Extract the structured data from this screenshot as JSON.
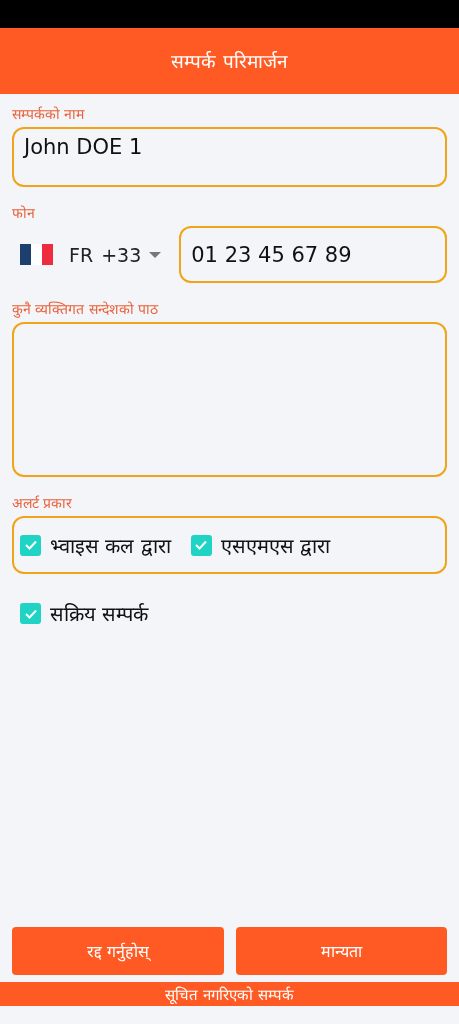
{
  "header": {
    "title": "सम्पर्क परिमार्जन"
  },
  "name_field": {
    "label": "सम्पर्कको नाम",
    "value": "John DOE 1"
  },
  "phone": {
    "label": "फोन",
    "country": "FR",
    "dial_code": "+33",
    "value": "01 23 45 67 89"
  },
  "message_field": {
    "label": "कुनै व्यक्तिगत सन्देशको पाठ"
  },
  "alert_type": {
    "label": "अलर्ट प्रकार",
    "options": [
      {
        "label": "भ्वाइस कल द्वारा",
        "checked": true
      },
      {
        "label": "एसएमएस द्वारा",
        "checked": true
      }
    ]
  },
  "active_contact": {
    "label": "सक्रिय सम्पर्क",
    "checked": true
  },
  "buttons": [
    "रद्द गर्नुहोस्",
    "मान्यता"
  ],
  "footer": {
    "text": "सूचित नगरिएको सम्पर्क"
  }
}
